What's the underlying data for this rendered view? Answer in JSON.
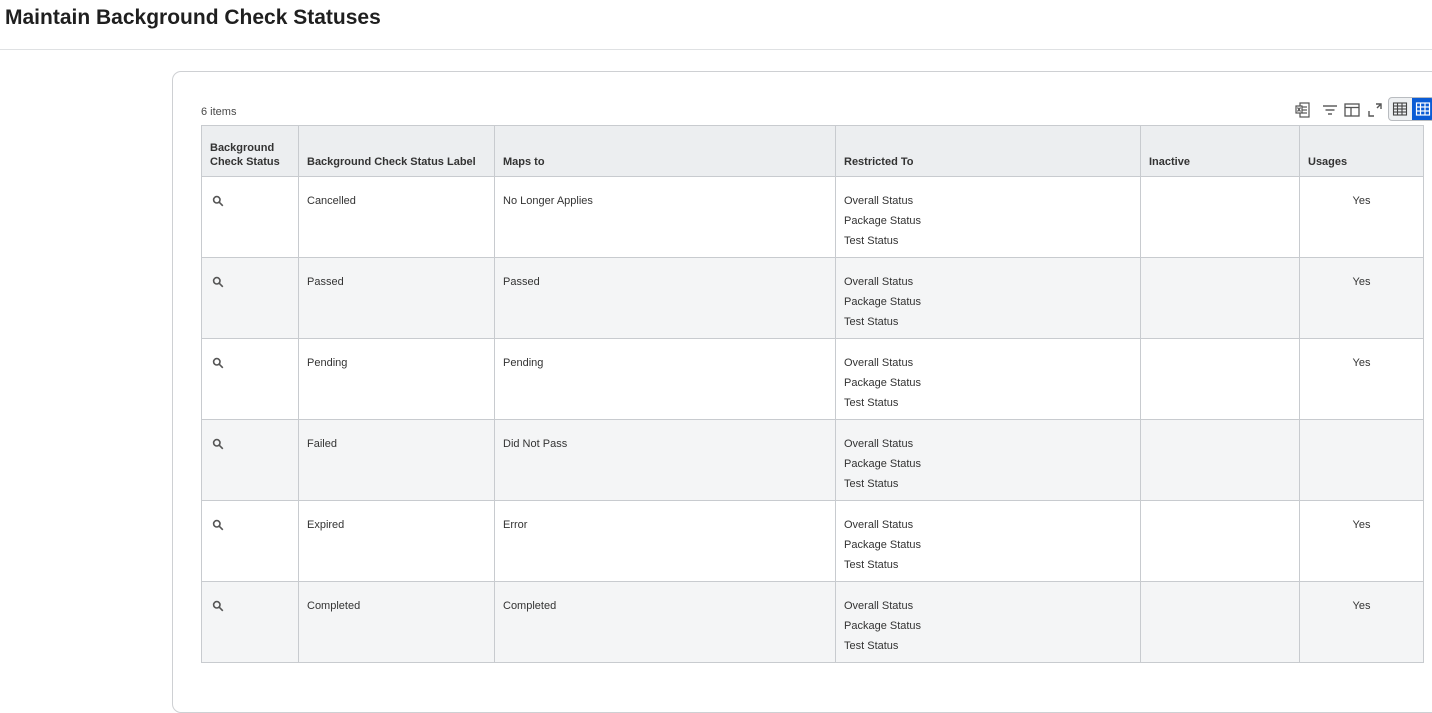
{
  "page": {
    "title": "Maintain Background Check Statuses"
  },
  "grid": {
    "item_count": "6 items",
    "columns": [
      {
        "line1": "Background",
        "line2": "Check Status"
      },
      {
        "line1": "Background Check Status Label",
        "line2": ""
      },
      {
        "line1": "Maps to",
        "line2": ""
      },
      {
        "line1": "Restricted To",
        "line2": ""
      },
      {
        "line1": "Inactive",
        "line2": ""
      },
      {
        "line1": "Usages",
        "line2": ""
      }
    ],
    "rows": [
      {
        "label": "Cancelled",
        "maps_to": "No Longer Applies",
        "restricted": [
          "Overall Status",
          "Package Status",
          "Test Status"
        ],
        "inactive": "",
        "usages": "Yes"
      },
      {
        "label": "Passed",
        "maps_to": "Passed",
        "restricted": [
          "Overall Status",
          "Package Status",
          "Test Status"
        ],
        "inactive": "",
        "usages": "Yes"
      },
      {
        "label": "Pending",
        "maps_to": "Pending",
        "restricted": [
          "Overall Status",
          "Package Status",
          "Test Status"
        ],
        "inactive": "",
        "usages": "Yes"
      },
      {
        "label": "Failed",
        "maps_to": "Did Not Pass",
        "restricted": [
          "Overall Status",
          "Package Status",
          "Test Status"
        ],
        "inactive": "",
        "usages": ""
      },
      {
        "label": "Expired",
        "maps_to": "Error",
        "restricted": [
          "Overall Status",
          "Package Status",
          "Test Status"
        ],
        "inactive": "",
        "usages": "Yes"
      },
      {
        "label": "Completed",
        "maps_to": "Completed",
        "restricted": [
          "Overall Status",
          "Package Status",
          "Test Status"
        ],
        "inactive": "",
        "usages": "Yes"
      }
    ]
  },
  "toolbar": {
    "icons": [
      "export-to-excel-icon",
      "filter-icon",
      "column-layout-icon",
      "fullscreen-icon",
      "table-view-icon",
      "grid-view-icon"
    ],
    "active_color": "#0b5cd5"
  }
}
